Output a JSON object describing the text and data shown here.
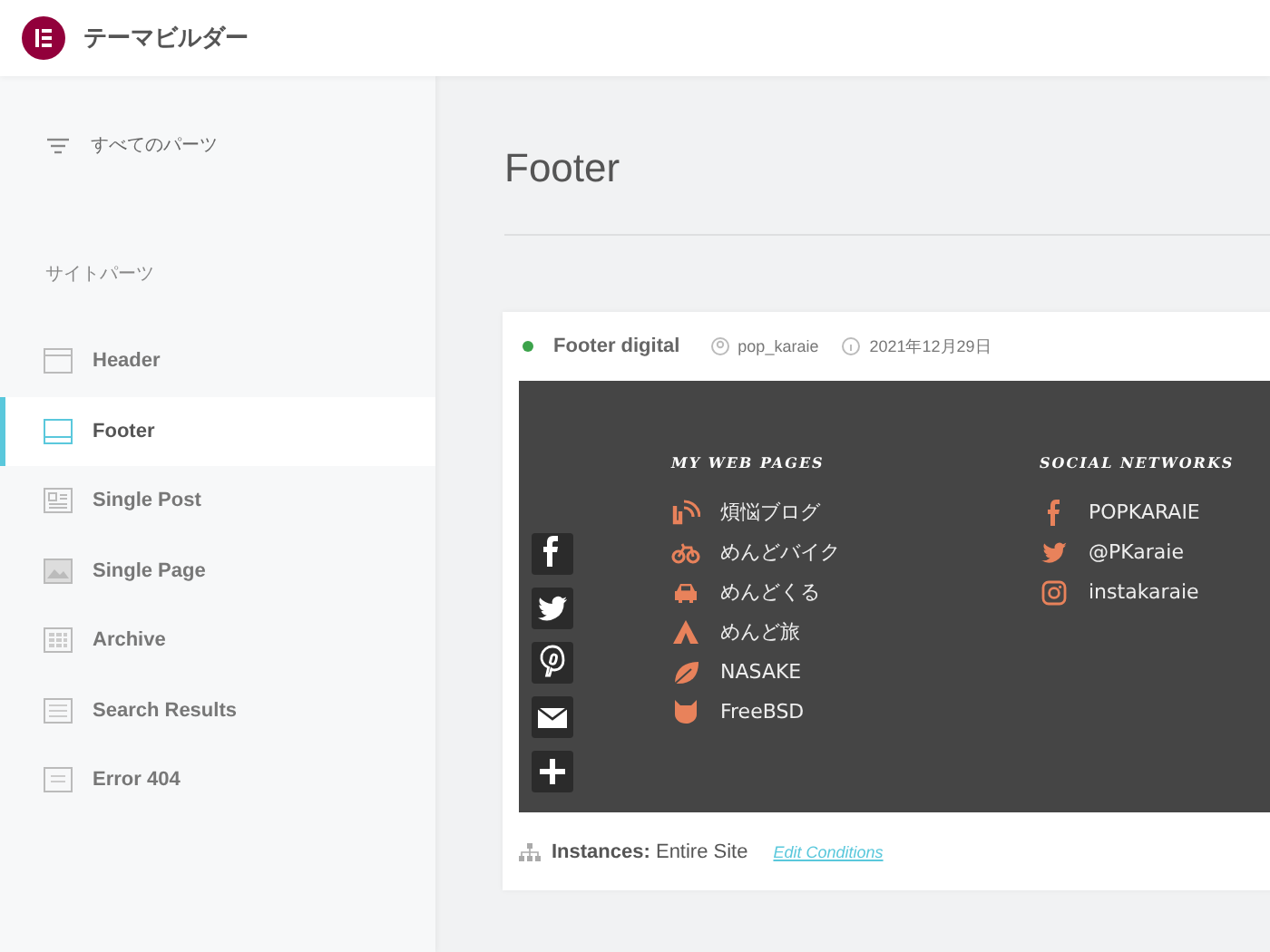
{
  "app": {
    "title": "テーマビルダー"
  },
  "sidebar": {
    "all_parts": "すべてのパーツ",
    "section": "サイトパーツ",
    "items": [
      {
        "kind": "header",
        "label": "Header",
        "selected": false
      },
      {
        "kind": "footer",
        "label": "Footer",
        "selected": true
      },
      {
        "kind": "post",
        "label": "Single Post",
        "selected": false
      },
      {
        "kind": "page",
        "label": "Single Page",
        "selected": false
      },
      {
        "kind": "archive",
        "label": "Archive",
        "selected": false
      },
      {
        "kind": "search",
        "label": "Search Results",
        "selected": false
      },
      {
        "kind": "error",
        "label": "Error 404",
        "selected": false
      }
    ]
  },
  "main": {
    "title": "Footer",
    "template": {
      "published": true,
      "name": "Footer digital",
      "author": "pop_karaie",
      "date": "2021年12月29日",
      "preview": {
        "share_buttons": [
          {
            "kind": "facebook"
          },
          {
            "kind": "twitter"
          },
          {
            "kind": "pinterest"
          },
          {
            "kind": "email"
          },
          {
            "kind": "more"
          }
        ],
        "columns": [
          {
            "heading": "MY WEB PAGES",
            "links": [
              {
                "kind": "rss",
                "label": "煩悩ブログ"
              },
              {
                "kind": "bike",
                "label": "めんどバイク"
              },
              {
                "kind": "car",
                "label": "めんどくる"
              },
              {
                "kind": "tent",
                "label": "めんど旅"
              },
              {
                "kind": "leaf",
                "label": "NASAKE"
              },
              {
                "kind": "devil",
                "label": "FreeBSD"
              }
            ]
          },
          {
            "heading": "SOCIAL NETWORKS",
            "links": [
              {
                "kind": "facebook",
                "label": "POPKARAIE"
              },
              {
                "kind": "twitter",
                "label": "@PKaraie"
              },
              {
                "kind": "instagram",
                "label": "instakaraie"
              }
            ]
          }
        ]
      },
      "instances": "**Instances:** Entire Site",
      "edit_link": "Edit Conditions"
    }
  }
}
